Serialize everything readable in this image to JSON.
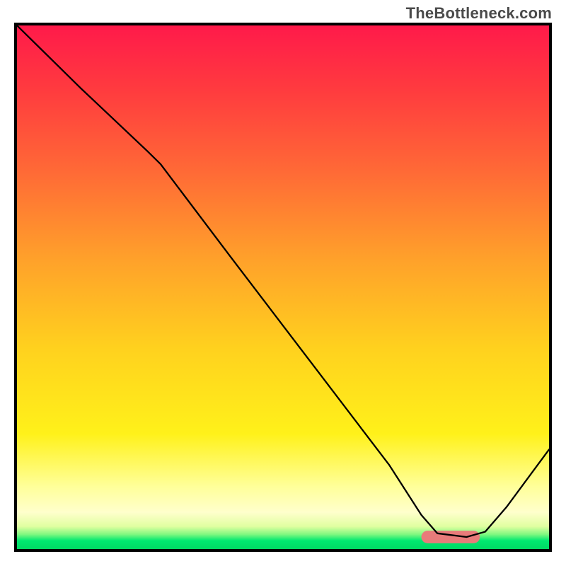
{
  "watermark": "TheBottleneck.com",
  "chart_data": {
    "type": "line",
    "title": "",
    "xlabel": "",
    "ylabel": "",
    "xlim": [
      0,
      100
    ],
    "ylim": [
      0,
      100
    ],
    "grid": false,
    "legend": false,
    "background_gradient": {
      "stops": [
        {
          "offset": 0.0,
          "color": "#ff1a4a"
        },
        {
          "offset": 0.12,
          "color": "#ff3a3f"
        },
        {
          "offset": 0.28,
          "color": "#ff6a36"
        },
        {
          "offset": 0.45,
          "color": "#ffa22a"
        },
        {
          "offset": 0.62,
          "color": "#ffd21e"
        },
        {
          "offset": 0.78,
          "color": "#fff11a"
        },
        {
          "offset": 0.88,
          "color": "#ffff99"
        },
        {
          "offset": 0.93,
          "color": "#ffffcc"
        },
        {
          "offset": 0.957,
          "color": "#e0ffa0"
        },
        {
          "offset": 0.972,
          "color": "#80f880"
        },
        {
          "offset": 0.984,
          "color": "#00e870"
        },
        {
          "offset": 1.0,
          "color": "#00d964"
        }
      ]
    },
    "series": [
      {
        "name": "bottleneck-curve",
        "color": "#000000",
        "stroke_width": 2.3,
        "x": [
          0.0,
          12.0,
          24.5,
          27.0,
          40.0,
          55.0,
          70.0,
          76.0,
          79.0,
          84.5,
          88.0,
          92.0,
          100.0
        ],
        "y": [
          100.0,
          88.0,
          76.0,
          73.5,
          56.0,
          36.0,
          16.0,
          6.5,
          3.0,
          2.3,
          3.3,
          8.0,
          19.0
        ]
      }
    ],
    "marker": {
      "name": "optimal-range",
      "shape": "stadium",
      "color": "#e87b7a",
      "x_center": 81.5,
      "y_center": 2.3,
      "width": 11.0,
      "height": 2.4
    }
  }
}
